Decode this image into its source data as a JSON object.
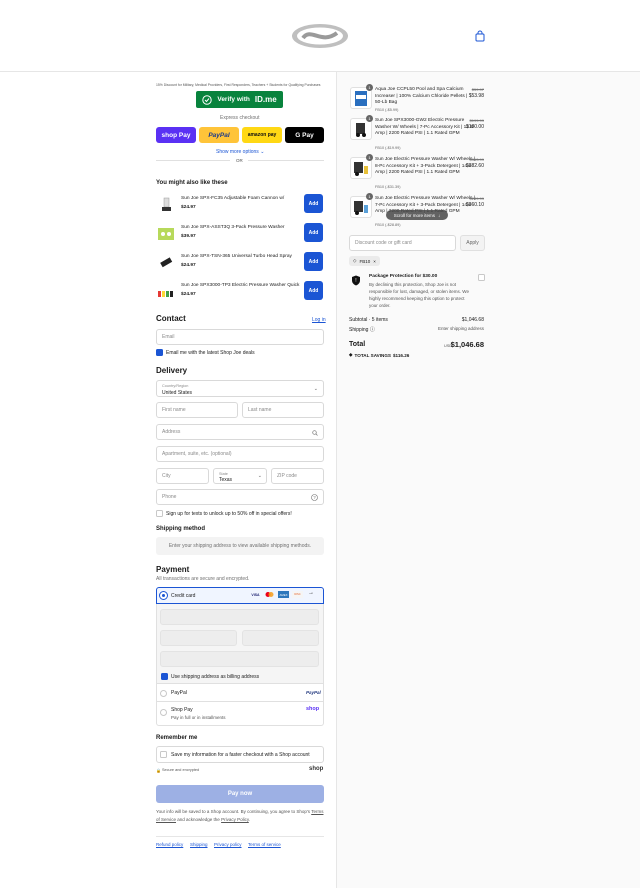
{
  "header": {
    "logo_icon": "brand-swoosh-logo",
    "cart_icon": "shopping-bag-icon"
  },
  "idme": {
    "discount_text": "15% Discount for Military, Medical Providers, First Responders, Teachers + Students for Qualifying Purchases",
    "button_prefix": "Verify with",
    "button_brand": "ID.me"
  },
  "express": {
    "label": "Express checkout",
    "buttons": [
      "shop Pay",
      "PayPal",
      "amazon pay",
      "G Pay"
    ],
    "show_more": "Show more options",
    "or": "OR"
  },
  "recommendations": {
    "title": "You might also like these",
    "add_label": "Add",
    "items": [
      {
        "name": "Sun Joe SPX-FC35 Adjustable Foam Cannon w/",
        "price": "$24.97"
      },
      {
        "name": "Sun Joe SPX-ASST3Q 3-Pack Pressure Washer",
        "price": "$39.97"
      },
      {
        "name": "Sun Joe SPX-TSN-365 Universal Turbo Head Spray",
        "price": "$24.97"
      },
      {
        "name": "Sun Joe SPX3000-TP3 Electric Pressure Washer Quick",
        "price": "$24.97"
      }
    ]
  },
  "contact": {
    "title": "Contact",
    "login": "Log in",
    "email_placeholder": "Email",
    "news_label": "Email me with the latest Shop Joe deals"
  },
  "delivery": {
    "title": "Delivery",
    "country_label": "Country/Region",
    "country_value": "United States",
    "first_name": "First name",
    "last_name": "Last name",
    "address": "Address",
    "apartment": "Apartment, suite, etc. (optional)",
    "city": "City",
    "state_label": "State",
    "state_value": "Texas",
    "zip": "ZIP code",
    "phone": "Phone",
    "sms_label": "Sign up for texts to unlock up to 50% off in special offers!"
  },
  "shipping_method": {
    "title": "Shipping method",
    "notice": "Enter your shipping address to view available shipping methods."
  },
  "payment": {
    "title": "Payment",
    "subtitle": "All transactions are secure and encrypted.",
    "credit_card": "Credit card",
    "card_brands": [
      "VISA",
      "MC",
      "AMEX",
      "DISC"
    ],
    "billing_label": "Use shipping address as billing address",
    "paypal": "PayPal",
    "paypal_brand": "PayPal",
    "shop_pay": "Shop Pay",
    "shop_pay_sub": "Pay in full or in installments",
    "shop_brand": "shop"
  },
  "remember": {
    "title": "Remember me",
    "label": "Save my information for a faster checkout with a Shop account",
    "secure": "Secure and encrypted",
    "shop_brand": "shop"
  },
  "pay_now": "Pay now",
  "legal": {
    "line1": "Your info will be saved to a Shop account. By continuing, you agree to Shop's",
    "terms": "Terms of Service",
    "mid": "and acknowledge the",
    "privacy": "Privacy Policy",
    "end": "."
  },
  "footer_links": [
    "Refund policy",
    "Shipping",
    "Privacy policy",
    "Terms of service"
  ],
  "order": {
    "items": [
      {
        "qty": "1",
        "name": "Aqua Joe CCPL50 Pool and Spa Calcium Increaser | 100% Calcium Chloride Pellets | 50-Lb Bag",
        "old": "$59.97",
        "price": "$53.98",
        "discount": "FB10 (-$5.99)"
      },
      {
        "qty": "1",
        "name": "Sun Joe SPX3000-GW2 Electric Pressure Washer W/ Wheels | 7-Pc Accessory Kit | 14.5-Amp | 2200 Rated PSI | 1.1 Rated GPM",
        "old": "$199.99",
        "price": "$180.00",
        "discount": "FB10 (-$19.99)"
      },
      {
        "qty": "1",
        "name": "Sun Joe Electric Pressure Washer W/ Wheels | 8-Pc Accessory Kit + 3-Pack Detergent | 14.5-Amp | 2200 Rated PSI | 1.1 Rated GPM",
        "old": "$313.99",
        "price": "$282.60",
        "discount": "FB10 (-$31.39)"
      },
      {
        "qty": "1",
        "name": "Sun Joe Electric Pressure Washer W/ Wheels | 7-Pc Accessory Kit + 3-Pack Detergent | 14.5-Amp | 2200 Rated PSI | 1.1 Rated GPM",
        "old": "$289.99",
        "price": "$260.10",
        "discount": "FB10 (-$28.89)"
      }
    ],
    "scroll_hint": "Scroll for more items",
    "code_placeholder": "Discount code or gift card",
    "apply": "Apply",
    "applied_code": "FB10",
    "protection_title": "Package Protection for $30.00",
    "protection_desc": "By declining this protection, Shop Joe is not responsible for lost, damaged, or stolen items. We highly recommend keeping this option to protect your order.",
    "subtotal_label": "Subtotal · 5 items",
    "subtotal_value": "$1,046.68",
    "shipping_label": "Shipping",
    "shipping_value": "Enter shipping address",
    "total_label": "Total",
    "currency": "USD",
    "total_value": "$1,046.68",
    "savings_label": "TOTAL SAVINGS",
    "savings_value": "$116.26"
  },
  "colors": {
    "accent": "#1b55d4",
    "idme_green": "#08833d",
    "paypal_yellow": "#ffc439",
    "amazon_yellow": "#ffd814",
    "shop_purple": "#5a31f4"
  }
}
